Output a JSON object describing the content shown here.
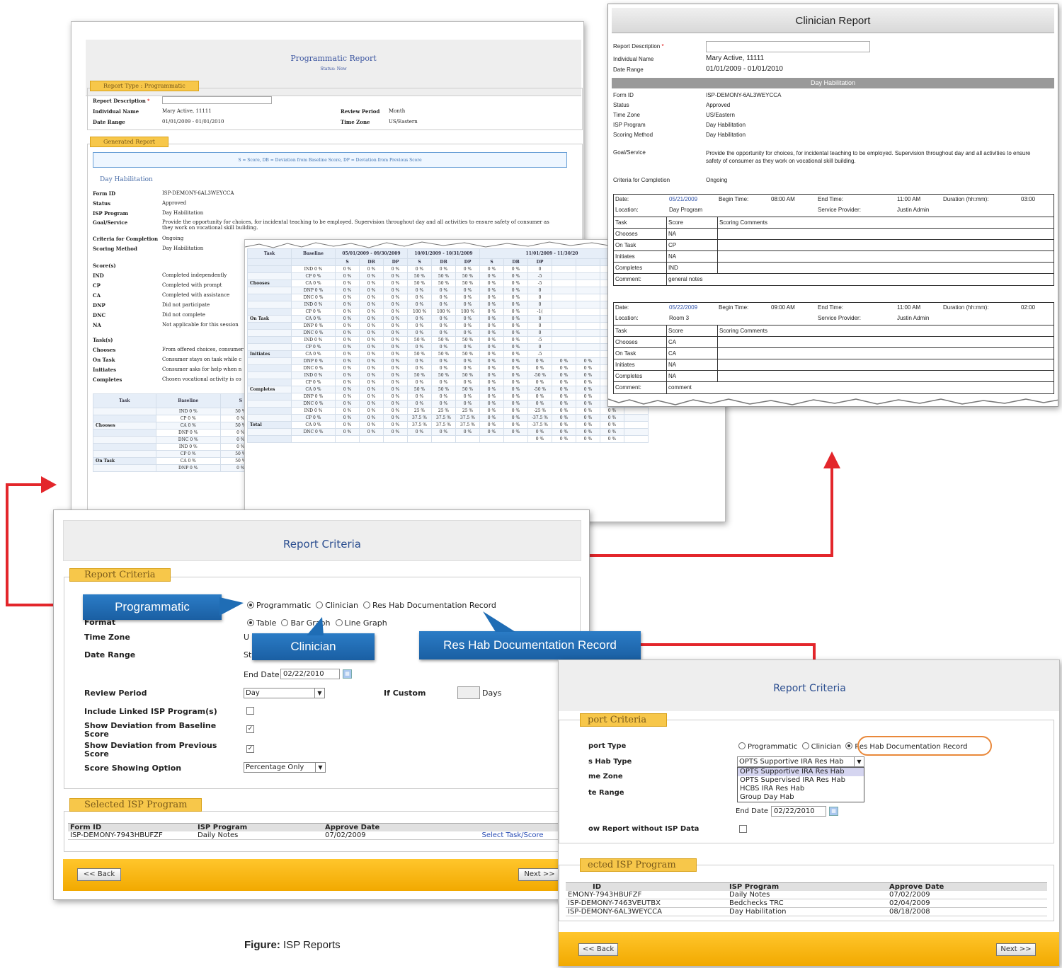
{
  "programmatic": {
    "title": "Programmatic Report",
    "status": "Status: New",
    "report_type_tab": "Report Type : Programmatic",
    "fields": [
      {
        "label": "Report Description",
        "value": ""
      },
      {
        "label": "Individual Name",
        "value": "Mary Active, 11111"
      },
      {
        "label": "Date Range",
        "value": "01/01/2009 - 01/01/2010"
      }
    ],
    "review_period_label": "Review Period",
    "review_period_value": "Month",
    "time_zone_label": "Time Zone",
    "time_zone_value": "US/Eastern",
    "generated_tab": "Generated Report",
    "legend": "S = Score, DB = Deviation from Baseline Score, DP = Deviation from Previous Score",
    "section": "Day Habilitation",
    "details": [
      {
        "label": "Form ID",
        "value": "ISP-DEMONY-6AL3WEYCCA"
      },
      {
        "label": "Status",
        "value": "Approved"
      },
      {
        "label": "ISP Program",
        "value": "Day Habilitation"
      },
      {
        "label": "Goal/Service",
        "value": "Provide the opportunity for choices, for incidental teaching to be employed. Supervision throughout day and all activities to ensure safety of consumer as they work on vocational skill building."
      },
      {
        "label": "Criteria for Completion",
        "value": "Ongoing"
      },
      {
        "label": "Scoring Method",
        "value": "Day Habilitation"
      }
    ],
    "scores_heading": "Score(s)",
    "scores": [
      {
        "code": "IND",
        "desc": "Completed independently"
      },
      {
        "code": "CP",
        "desc": "Completed with prompt"
      },
      {
        "code": "CA",
        "desc": "Completed with assistance"
      },
      {
        "code": "DNP",
        "desc": "Did not participate"
      },
      {
        "code": "DNC",
        "desc": "Did not complete"
      },
      {
        "code": "NA",
        "desc": "Not applicable for this session"
      }
    ],
    "tasks_heading": "Task(s)",
    "tasks": [
      {
        "code": "Chooses",
        "desc": "From offered choices, consumer"
      },
      {
        "code": "On Task",
        "desc": "Consumer stays on task while c"
      },
      {
        "code": "Initiates",
        "desc": "Consumer asks for help when n"
      },
      {
        "code": "Completes",
        "desc": "Chosen vocational activity is co"
      }
    ],
    "small_table": {
      "headers": [
        "Task",
        "Baseline",
        "S"
      ],
      "period": "05/01/2",
      "rows": [
        [
          "",
          "IND  0 %",
          "50 %"
        ],
        [
          "",
          "CP  0 %",
          "0 %"
        ],
        [
          "Chooses",
          "CA  0 %",
          "50 %"
        ],
        [
          "",
          "DNP  0 %",
          "0 %"
        ],
        [
          "",
          "DNC  0 %",
          "0 %"
        ],
        [
          "",
          "IND  0 %",
          "0 %"
        ],
        [
          "",
          "CP  0 %",
          "50 %"
        ],
        [
          "On Task",
          "CA  0 %",
          "50 %"
        ],
        [
          "",
          "DNP  0 %",
          "0 %"
        ]
      ]
    }
  },
  "detail_table": {
    "periods": [
      "05/01/2009 - 09/30/2009",
      "10/01/2009 - 10/31/2009",
      "11/01/2009 - 11/30/20"
    ],
    "headers": [
      "Task",
      "Baseline",
      "S",
      "DB",
      "DP",
      "S",
      "DB",
      "DP",
      "S",
      "DB",
      "DP",
      "",
      "",
      "",
      ""
    ],
    "rows": [
      [
        "",
        "IND  0 %",
        "0 %",
        "0 %",
        "0 %",
        "0 %",
        "0 %",
        "0 %",
        "0 %",
        "0 %",
        "0",
        "",
        "",
        "",
        ""
      ],
      [
        "",
        "CP  0 %",
        "0 %",
        "0 %",
        "0 %",
        "50 %",
        "50 %",
        "50 %",
        "0 %",
        "0 %",
        "-5",
        "",
        "",
        "",
        ""
      ],
      [
        "Chooses",
        "CA  0 %",
        "0 %",
        "0 %",
        "0 %",
        "50 %",
        "50 %",
        "50 %",
        "0 %",
        "0 %",
        "-5",
        "",
        "",
        "",
        ""
      ],
      [
        "",
        "DNP  0 %",
        "0 %",
        "0 %",
        "0 %",
        "0 %",
        "0 %",
        "0 %",
        "0 %",
        "0 %",
        "0",
        "",
        "",
        "",
        ""
      ],
      [
        "",
        "DNC  0 %",
        "0 %",
        "0 %",
        "0 %",
        "0 %",
        "0 %",
        "0 %",
        "0 %",
        "0 %",
        "0",
        "",
        "",
        "",
        ""
      ],
      [
        "",
        "IND  0 %",
        "0 %",
        "0 %",
        "0 %",
        "0 %",
        "0 %",
        "0 %",
        "0 %",
        "0 %",
        "0",
        "",
        "",
        "",
        ""
      ],
      [
        "",
        "CP  0 %",
        "0 %",
        "0 %",
        "0 %",
        "100 %",
        "100 %",
        "100 %",
        "0 %",
        "0 %",
        "-1(",
        "",
        "",
        "",
        ""
      ],
      [
        "On Task",
        "CA  0 %",
        "0 %",
        "0 %",
        "0 %",
        "0 %",
        "0 %",
        "0 %",
        "0 %",
        "0 %",
        "0",
        "",
        "",
        "",
        ""
      ],
      [
        "",
        "DNP  0 %",
        "0 %",
        "0 %",
        "0 %",
        "0 %",
        "0 %",
        "0 %",
        "0 %",
        "0 %",
        "0",
        "",
        "",
        "",
        ""
      ],
      [
        "",
        "DNC  0 %",
        "0 %",
        "0 %",
        "0 %",
        "0 %",
        "0 %",
        "0 %",
        "0 %",
        "0 %",
        "0",
        "",
        "",
        "",
        ""
      ],
      [
        "",
        "IND  0 %",
        "0 %",
        "0 %",
        "0 %",
        "50 %",
        "50 %",
        "50 %",
        "0 %",
        "0 %",
        "-5",
        "",
        "",
        "",
        ""
      ],
      [
        "",
        "CP  0 %",
        "0 %",
        "0 %",
        "0 %",
        "0 %",
        "0 %",
        "0 %",
        "0 %",
        "0 %",
        "0",
        "",
        "",
        "",
        ""
      ],
      [
        "Initiates",
        "CA  0 %",
        "0 %",
        "0 %",
        "0 %",
        "50 %",
        "50 %",
        "50 %",
        "0 %",
        "0 %",
        "-5",
        "",
        "",
        "",
        ""
      ],
      [
        "",
        "DNP  0 %",
        "0 %",
        "0 %",
        "0 %",
        "0 %",
        "0 %",
        "0 %",
        "0 %",
        "0 %",
        "0 %",
        "0 %",
        "0 %",
        "0 %",
        ""
      ],
      [
        "",
        "DNC  0 %",
        "0 %",
        "0 %",
        "0 %",
        "0 %",
        "0 %",
        "0 %",
        "0 %",
        "0 %",
        "0 %",
        "0 %",
        "0 %",
        "0 %",
        ""
      ],
      [
        "",
        "IND  0 %",
        "0 %",
        "0 %",
        "0 %",
        "50 %",
        "50 %",
        "50 %",
        "0 %",
        "0 %",
        "-50 %",
        "0 %",
        "0 %",
        "0 %",
        ""
      ],
      [
        "",
        "CP  0 %",
        "0 %",
        "0 %",
        "0 %",
        "0 %",
        "0 %",
        "0 %",
        "0 %",
        "0 %",
        "0 %",
        "0 %",
        "0 %",
        "0 %",
        ""
      ],
      [
        "Completes",
        "CA  0 %",
        "0 %",
        "0 %",
        "0 %",
        "50 %",
        "50 %",
        "50 %",
        "0 %",
        "0 %",
        "-50 %",
        "0 %",
        "0 %",
        "0 %",
        ""
      ],
      [
        "",
        "DNP  0 %",
        "0 %",
        "0 %",
        "0 %",
        "0 %",
        "0 %",
        "0 %",
        "0 %",
        "0 %",
        "0 %",
        "0 %",
        "0 %",
        "0 %",
        ""
      ],
      [
        "",
        "DNC  0 %",
        "0 %",
        "0 %",
        "0 %",
        "0 %",
        "0 %",
        "0 %",
        "0 %",
        "0 %",
        "0 %",
        "0 %",
        "0 %",
        "0 %",
        ""
      ],
      [
        "",
        "IND  0 %",
        "0 %",
        "0 %",
        "0 %",
        "25 %",
        "25 %",
        "25 %",
        "0 %",
        "0 %",
        "-25 %",
        "0 %",
        "0 %",
        "0 %",
        ""
      ],
      [
        "",
        "CP  0 %",
        "0 %",
        "0 %",
        "0 %",
        "37.5 %",
        "37.5 %",
        "37.5 %",
        "0 %",
        "0 %",
        "-37.5 %",
        "0 %",
        "0 %",
        "0 %",
        ""
      ],
      [
        "Total",
        "CA  0 %",
        "0 %",
        "0 %",
        "0 %",
        "37.5 %",
        "37.5 %",
        "37.5 %",
        "0 %",
        "0 %",
        "-37.5 %",
        "0 %",
        "0 %",
        "0 %",
        ""
      ],
      [
        "",
        "DNC  0 %",
        "0 %",
        "0 %",
        "0 %",
        "0 %",
        "0 %",
        "0 %",
        "0 %",
        "0 %",
        "0 %",
        "0 %",
        "0 %",
        "0 %",
        ""
      ],
      [
        "",
        "",
        "",
        "",
        "",
        "",
        "",
        "",
        "",
        "",
        "0 %",
        "0 %",
        "0 %",
        "0 %",
        ""
      ]
    ]
  },
  "clinician": {
    "title": "Clinician Report",
    "report_description_label": "Report Description",
    "individual_name_label": "Individual Name",
    "individual_name_value": "Mary Active, 11111",
    "date_range_label": "Date Range",
    "date_range_value": "01/01/2009 - 01/01/2010",
    "band": "Day Habilitation",
    "details": [
      {
        "label": "Form ID",
        "value": "ISP-DEMONY-6AL3WEYCCA"
      },
      {
        "label": "Status",
        "value": "Approved"
      },
      {
        "label": "Time Zone",
        "value": "US/Eastern"
      },
      {
        "label": "ISP Program",
        "value": "Day Habilitation"
      },
      {
        "label": "Scoring Method",
        "value": "Day Habilitation"
      }
    ],
    "goal_label": "Goal/Service",
    "goal_value": "Provide the opportunity for choices, for incidental teaching to be employed. Supervision throughout day and all activities to ensure safety of consumer as they work on vocational skill building.",
    "criteria_label": "Criteria for Completion",
    "criteria_value": "Ongoing",
    "sessions": [
      {
        "date_label": "Date:",
        "date": "05/21/2009",
        "begin_label": "Begin Time:",
        "begin": "08:00 AM",
        "end_label": "End Time:",
        "end": "11:00 AM",
        "duration_label": "Duration (hh:mm):",
        "duration": "03:00",
        "location_label": "Location:",
        "location": "Day Program",
        "provider_label": "Service Provider:",
        "provider": "Justin Admin",
        "col_task": "Task",
        "col_score": "Score",
        "col_comments": "Scoring Comments",
        "rows": [
          [
            "Chooses",
            "NA"
          ],
          [
            "On Task",
            "CP"
          ],
          [
            "Initiates",
            "NA"
          ],
          [
            "Completes",
            "IND"
          ]
        ],
        "comment_label": "Comment:",
        "comment": "general notes"
      },
      {
        "date_label": "Date:",
        "date": "05/22/2009",
        "begin_label": "Begin Time:",
        "begin": "09:00 AM",
        "end_label": "End Time:",
        "end": "11:00 AM",
        "duration_label": "Duration (hh:mm):",
        "duration": "02:00",
        "location_label": "Location:",
        "location": "Room 3",
        "provider_label": "Service Provider:",
        "provider": "Justin Admin",
        "col_task": "Task",
        "col_score": "Score",
        "col_comments": "Scoring Comments",
        "rows": [
          [
            "Chooses",
            "CA"
          ],
          [
            "On Task",
            "CA"
          ],
          [
            "Initiates",
            "NA"
          ],
          [
            "Completes",
            "NA"
          ]
        ],
        "comment_label": "Comment:",
        "comment": "comment"
      }
    ]
  },
  "criteria": {
    "title": "Report Criteria",
    "tab": "Report Criteria",
    "report_types": [
      "Programmatic",
      "Clinician",
      "Res Hab Documentation Record"
    ],
    "format_label": "Format",
    "formats": [
      "Table",
      "Bar Graph",
      "Line Graph"
    ],
    "time_zone_label": "Time Zone",
    "time_zone_value": "U",
    "date_range_label": "Date Range",
    "start_label": "St",
    "end_date_label": "End Date",
    "end_date_value": "02/22/2010",
    "review_period_label": "Review Period",
    "review_period_value": "Day",
    "if_custom_label": "If Custom",
    "days_label": "Days",
    "linked_label": "Include Linked ISP Program(s)",
    "dev_baseline_label": "Show Deviation from Baseline Score",
    "dev_previous_label": "Show Deviation from Previous Score",
    "score_option_label": "Score Showing Option",
    "score_option_value": "Percentage Only",
    "selected_tab": "Selected ISP Program",
    "isp_headers": [
      "Form ID",
      "ISP Program",
      "Approve Date",
      ""
    ],
    "isp_rows": [
      [
        "ISP-DEMONY-7943HBUFZF",
        "Daily Notes",
        "07/02/2009",
        "Select Task/Score"
      ]
    ],
    "back": "<< Back",
    "next": "Next >>"
  },
  "callouts": {
    "programmatic": "Programmatic",
    "clinician": "Clinician",
    "reshab": "Res Hab Documentation Record"
  },
  "reshab": {
    "title": "Report Criteria",
    "tab": "port Criteria",
    "report_type_label": "port Type",
    "report_types": [
      "Programmatic",
      "Clinician",
      "Res Hab Documentation Record"
    ],
    "reshab_type_label": "s Hab Type",
    "reshab_type_value": "OPTS Supportive IRA Res Hab",
    "options": [
      "OPTS Supportive IRA Res Hab",
      "OPTS Supervised IRA Res Hab",
      "HCBS IRA Res Hab",
      "Group Day Hab"
    ],
    "time_zone_label": "me Zone",
    "date_range_label": "te Range",
    "end_date_label": "End Date",
    "end_date_value": "02/22/2010",
    "show_report_label": "ow Report without ISP Data",
    "selected_tab": "ected ISP Program",
    "isp_headers": [
      "ID",
      "ISP Program",
      "Approve Date"
    ],
    "isp_rows": [
      [
        "EMONY-7943HBUFZF",
        "Daily Notes",
        "07/02/2009"
      ],
      [
        "ISP-DEMONY-7463VEUTBX",
        "Bedchecks TRC",
        "02/04/2009"
      ],
      [
        "ISP-DEMONY-6AL3WEYCCA",
        "Day Habilitation",
        "08/18/2008"
      ]
    ],
    "back": "<< Back",
    "next": "Next >>"
  },
  "caption_label": "Figure:",
  "caption_text": "ISP Reports",
  "colors": {
    "accent_red": "#e3262b",
    "callout_blue": "#1f6db5",
    "tab_yellow": "#f7c74a",
    "bar_gold": "#f5b400"
  }
}
